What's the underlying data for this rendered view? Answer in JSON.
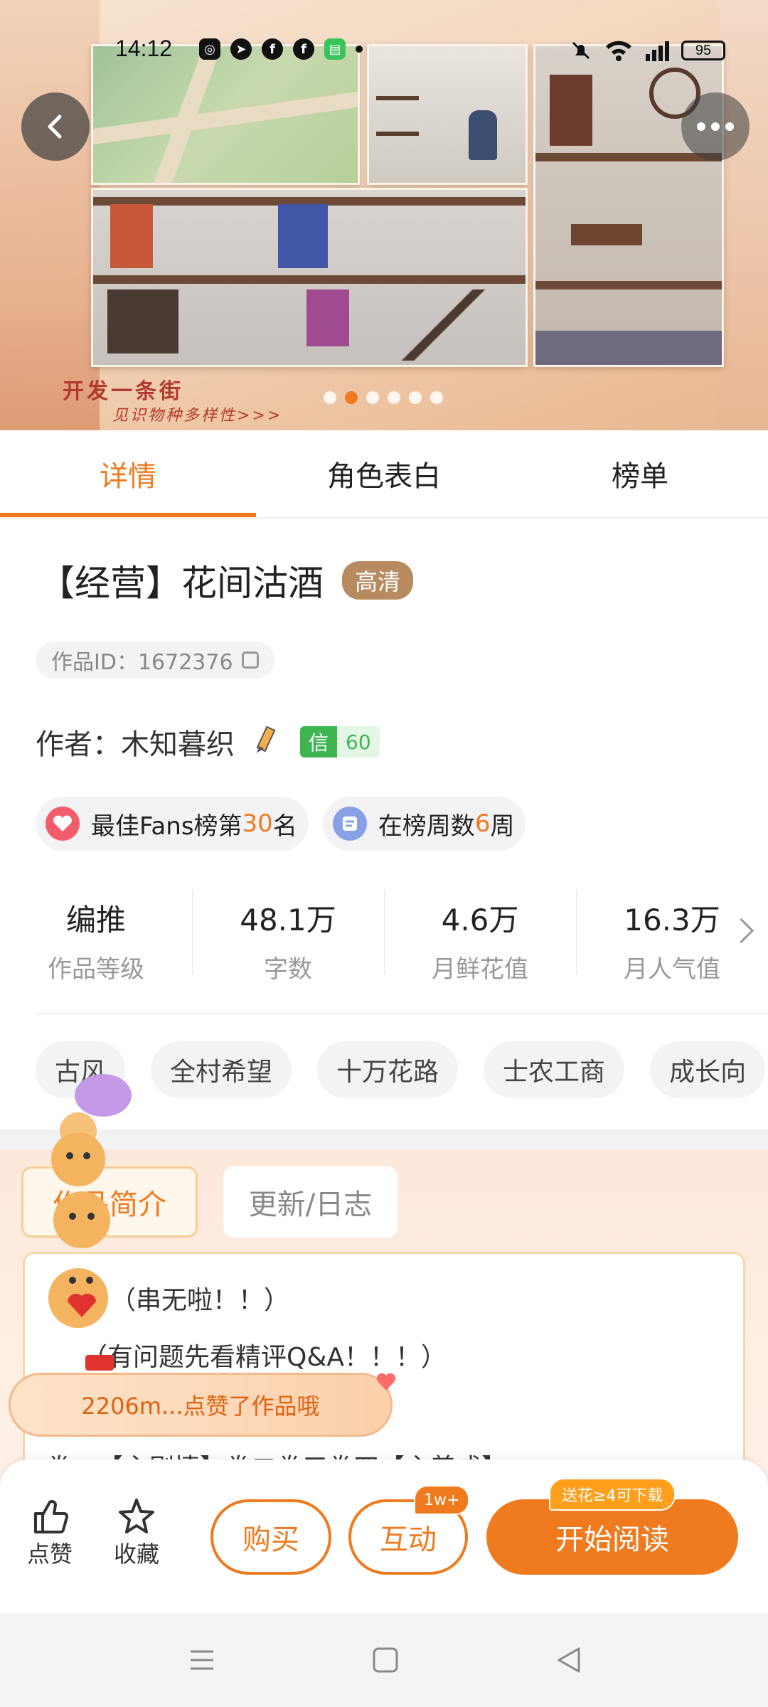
{
  "status_bar": {
    "time": "14:12",
    "battery": "95"
  },
  "hero": {
    "caption_line1": "开发一条街",
    "caption_line2": "见识物种多样性>>>",
    "slides_count": 6,
    "active_slide": 1
  },
  "tabs": [
    {
      "label": "详情",
      "active": true
    },
    {
      "label": "角色表白",
      "active": false
    },
    {
      "label": "榜单",
      "active": false
    }
  ],
  "work": {
    "title": "【经营】花间沽酒",
    "hd_badge": "高清",
    "id_text": "作品ID：1672376",
    "author_text": "作者：木知暮织",
    "credit_label": "信",
    "credit_value": "60"
  },
  "rank_chips": [
    {
      "prefix": "最佳Fans榜第",
      "highlight": "30",
      "suffix": "名"
    },
    {
      "prefix": "在榜周数",
      "highlight": "6",
      "suffix": "周"
    }
  ],
  "stats": [
    {
      "value": "编推",
      "label": "作品等级"
    },
    {
      "value": "48.1万",
      "label": "字数"
    },
    {
      "value": "4.6万",
      "label": "月鲜花值"
    },
    {
      "value": "16.3万",
      "label": "月人气值"
    }
  ],
  "tags": [
    "古风",
    "全村希望",
    "十万花路",
    "士农工商",
    "成长向"
  ],
  "intro": {
    "tab_active": "作品简介",
    "tab_inactive": "更新/日志",
    "lines": [
      "（串无啦！！）",
      "（有问题先看精评Q&A！！！）",
      "卷一【主剧情】卷二卷三卷四【主养成】"
    ]
  },
  "toast": {
    "text": "2206m...点赞了作品哦"
  },
  "actions": {
    "like": "点赞",
    "favorite": "收藏",
    "buy": "购买",
    "interact": "互动",
    "interact_badge": "1w+",
    "read": "开始阅读",
    "read_badge": "送花≥4可下载"
  },
  "colors": {
    "accent": "#f07a1e",
    "credit_green": "#3fb552",
    "hd_badge": "#b78a60"
  }
}
